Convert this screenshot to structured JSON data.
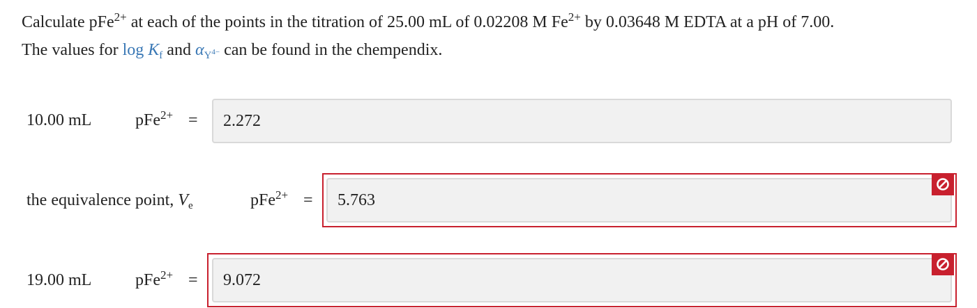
{
  "question": {
    "line1_a": "Calculate pFe",
    "charge": "2+",
    "line1_b": " at each of the points in the titration of 25.00 mL of 0.02208 M Fe",
    "line1_c": " by 0.03648 M EDTA at a pH of 7.00.",
    "line2_a": "The values for ",
    "logkf_log": "log ",
    "logkf_K": "K",
    "logkf_sub": "f",
    "line2_and": " and ",
    "alpha_symbol": "α",
    "alpha_sub_Y": "Y",
    "alpha_sub_charge": "4−",
    "line2_b": " can be found in the chempendix."
  },
  "rows": [
    {
      "label": "10.00 mL",
      "quantity": "pFe",
      "charge": "2+",
      "equals": "=",
      "value": "2.272",
      "status": "none"
    },
    {
      "label_prefix": "the equivalence point, ",
      "label_var": "V",
      "label_sub": "e",
      "quantity": "pFe",
      "charge": "2+",
      "equals": "=",
      "value": "5.763",
      "status": "incorrect"
    },
    {
      "label": "19.00 mL",
      "quantity": "pFe",
      "charge": "2+",
      "equals": "=",
      "value": "9.072",
      "status": "incorrect"
    }
  ],
  "icons": {
    "incorrect": "prohibited-icon"
  },
  "colors": {
    "error": "#c8202e",
    "link": "#3a78b5",
    "field_bg": "#f1f1f1",
    "field_border": "#d9d9d9"
  }
}
